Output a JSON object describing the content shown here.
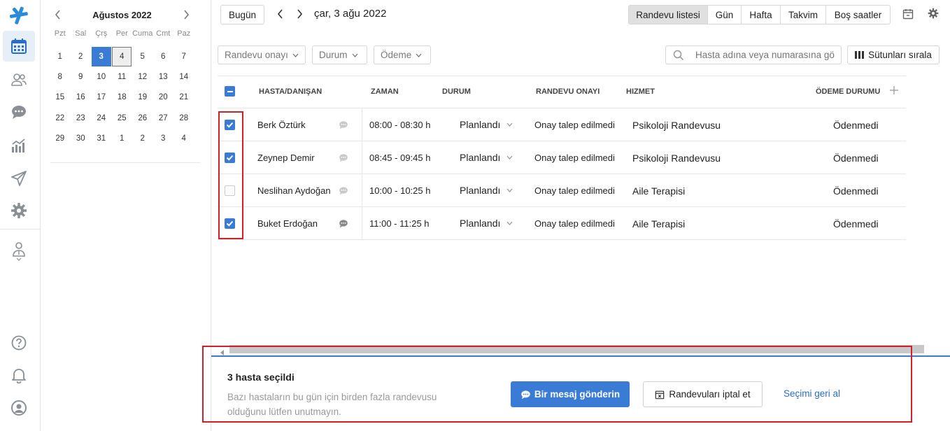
{
  "calendar": {
    "title": "Ağustos 2022",
    "weekdays": [
      "Pzt",
      "Sal",
      "Çrş",
      "Per",
      "Cuma",
      "Cmt",
      "Paz"
    ],
    "weeks": [
      [
        "1",
        "2",
        "3",
        "4",
        "5",
        "6",
        "7"
      ],
      [
        "8",
        "9",
        "10",
        "11",
        "12",
        "13",
        "14"
      ],
      [
        "15",
        "16",
        "17",
        "18",
        "19",
        "20",
        "21"
      ],
      [
        "22",
        "23",
        "24",
        "25",
        "26",
        "27",
        "28"
      ],
      [
        "29",
        "30",
        "31",
        "1",
        "2",
        "3",
        "4"
      ]
    ],
    "selected_day": "3",
    "today_day": "4"
  },
  "toolbar": {
    "today_label": "Bugün",
    "current_date": "çar, 3 ağu 2022",
    "views": [
      "Randevu listesi",
      "Gün",
      "Hafta",
      "Takvim",
      "Boş saatler"
    ],
    "active_view": "Randevu listesi"
  },
  "filters": {
    "approval_label": "Randevu onayı",
    "status_label": "Durum",
    "payment_label": "Ödeme",
    "search_placeholder": "Hasta adına veya numarasına gö",
    "sort_columns_label": "Sütunları sırala"
  },
  "table": {
    "headers": {
      "patient": "HASTA/DANIŞAN",
      "time": "ZAMAN",
      "status": "DURUM",
      "approval": "RANDEVU ONAYI",
      "service": "HIZMET",
      "payment": "ÖDEME DURUMU"
    },
    "rows": [
      {
        "checked": true,
        "name": "Berk Öztürk",
        "time": "08:00 - 08:30 h",
        "status": "Planlandı",
        "approval": "Onay talep edilmedi",
        "service": "Psikoloji Randevusu",
        "payment": "Ödenmedi",
        "msg_dark": false
      },
      {
        "checked": true,
        "name": "Zeynep Demir",
        "time": "08:45 - 09:45 h",
        "status": "Planlandı",
        "approval": "Onay talep edilmedi",
        "service": "Psikoloji Randevusu",
        "payment": "Ödenmedi",
        "msg_dark": false
      },
      {
        "checked": false,
        "name": "Neslihan Aydoğan",
        "time": "10:00 - 10:25 h",
        "status": "Planlandı",
        "approval": "Onay talep edilmedi",
        "service": "Aile Terapisi",
        "payment": "Ödenmedi",
        "msg_dark": false
      },
      {
        "checked": true,
        "name": "Buket Erdoğan",
        "time": "11:00 - 11:25 h",
        "status": "Planlandı",
        "approval": "Onay talep edilmedi",
        "service": "Aile Terapisi",
        "payment": "Ödenmedi",
        "msg_dark": true
      }
    ]
  },
  "selection_bar": {
    "title": "3 hasta seçildi",
    "note_line1": "Bazı hastaların bu gün için birden fazla randevusu",
    "note_line2": "olduğunu lütfen unutmayın.",
    "send_message_label": "Bir mesaj gönderin",
    "cancel_label": "Randevuları iptal et",
    "undo_label": "Seçimi geri al"
  },
  "colors": {
    "accent": "#3a7bd5",
    "highlight_box": "#d0202a",
    "logo": "#2a8bd8"
  }
}
